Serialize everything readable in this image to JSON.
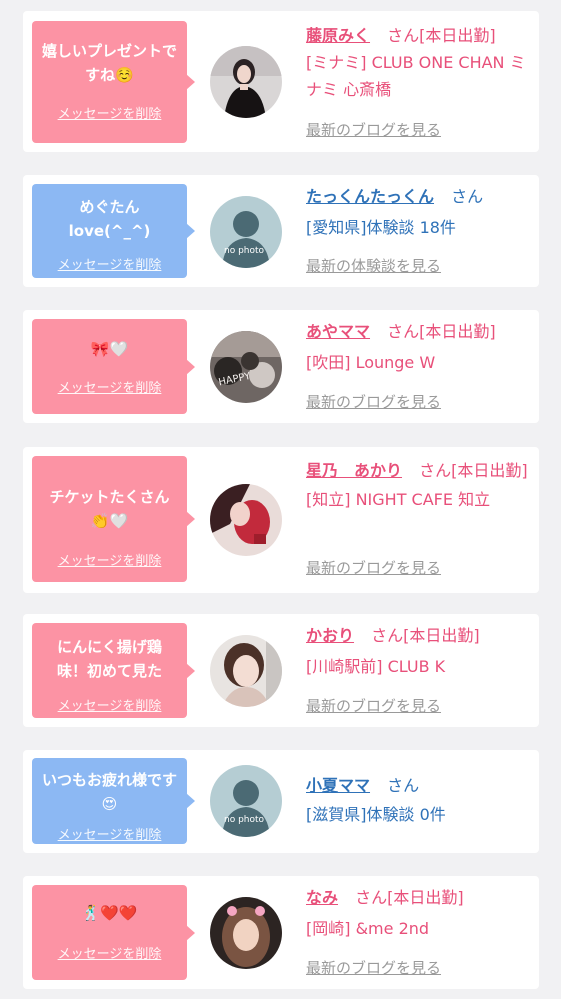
{
  "delete_label": "メッセージを削除",
  "san": "さん",
  "colors": {
    "pink_bubble": "#fc93a4",
    "blue_bubble": "#8cb8f3",
    "pink_text": "#e8507a",
    "blue_text": "#2f72b8"
  },
  "items": [
    {
      "bubble_color": "pink",
      "message": "嬉しいプレゼントですね☺️",
      "avatar": "photo-woman-black-dress",
      "name": "藤原みく",
      "status": "[本日出勤]",
      "details": "[ミナミ] CLUB ONE CHAN ミナミ 心斎橋",
      "more": "最新のブログを見る"
    },
    {
      "bubble_color": "blue",
      "message": "めぐたんlove(^_^)",
      "avatar": "no-photo-silhouette",
      "name": "たっくんたっくん",
      "status": "",
      "details": "[愛知県]体験談 18件",
      "more": "最新の体験談を見る"
    },
    {
      "bubble_color": "pink",
      "message": "🎀🤍",
      "avatar": "photo-birthday-balloons",
      "name": "あやママ",
      "status": "[本日出勤]",
      "details": "[吹田] Lounge W",
      "more": "最新のブログを見る"
    },
    {
      "bubble_color": "pink",
      "message": "チケットたくさん👏🤍",
      "avatar": "photo-woman-red",
      "name": "星乃　あかり",
      "status": "[本日出勤]",
      "details": "[知立] NIGHT CAFE 知立",
      "more": "最新のブログを見る"
    },
    {
      "bubble_color": "pink",
      "message": "にんにく揚げ鶏味！初めて見た",
      "avatar": "photo-woman-short-hair",
      "name": "かおり",
      "status": "[本日出勤]",
      "details": "[川崎駅前] CLUB K",
      "more": "最新のブログを見る"
    },
    {
      "bubble_color": "blue",
      "message": "いつもお疲れ様です😍",
      "avatar": "no-photo-silhouette",
      "name": "小夏ママ",
      "status": "",
      "details": "[滋賀県]体験談 0件",
      "more": ""
    },
    {
      "bubble_color": "pink",
      "message": "🕺❤️❤️",
      "avatar": "photo-woman-long-hair",
      "name": "なみ",
      "status": "[本日出勤]",
      "details": "[岡崎] &me 2nd",
      "more": "最新のブログを見る"
    }
  ]
}
